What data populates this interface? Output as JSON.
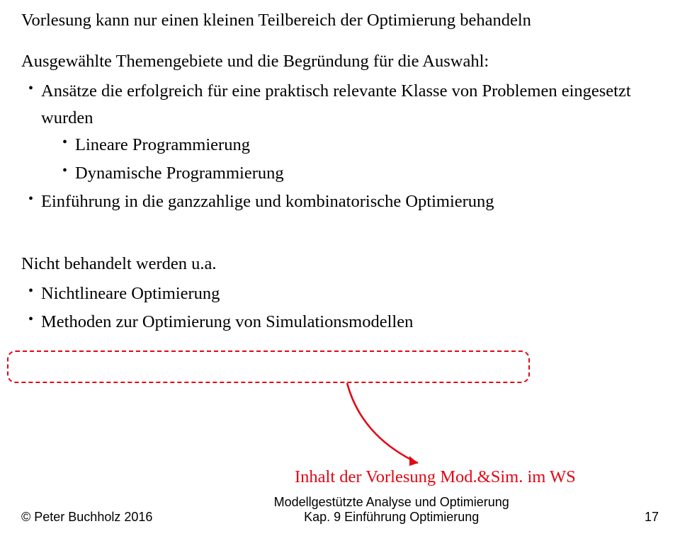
{
  "intro_line1": "Vorlesung kann nur einen kleinen Teilbereich der Optimierung behandeln",
  "intro_line2": "Ausgewählte Themengebiete und die Begründung für die Auswahl:",
  "bullets_l1": [
    "Ansätze die erfolgreich für eine praktisch relevante Klasse von Problemen eingesetzt wurden",
    "Einführung in die ganzzahlige und kombinatorische Optimierung"
  ],
  "bullets_l2": [
    "Lineare Programmierung",
    "Dynamische Programmierung"
  ],
  "not_handled_heading": "Nicht behandelt werden u.a.",
  "not_handled_items": [
    "Nichtlineare Optimierung",
    "Methoden zur Optimierung von Simulationsmodellen"
  ],
  "red_note": "Inhalt der Vorlesung Mod.&Sim. im WS",
  "footer": {
    "copyright_symbol": "©",
    "left": " Peter Buchholz 2016",
    "center_line1": "Modellgestützte Analyse und Optimierung",
    "center_line2": "Kap. 9 Einführung Optimierung",
    "pagenum": "17"
  },
  "colors": {
    "red": "#e30613"
  }
}
